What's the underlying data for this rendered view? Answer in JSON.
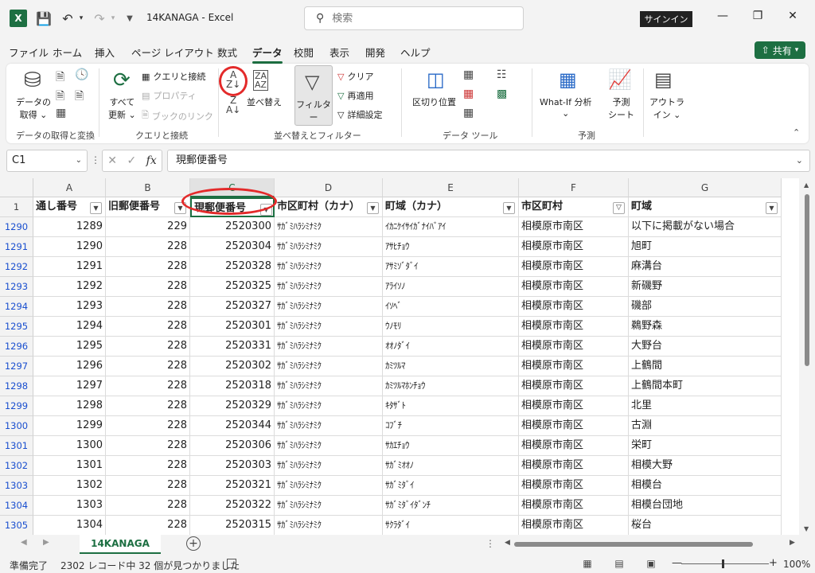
{
  "window": {
    "app_icon": "X",
    "title": "14KANAGA  -  Excel",
    "search_placeholder": "検索",
    "signin": "サインイン"
  },
  "menu": {
    "tabs": [
      "ファイル",
      "ホーム",
      "挿入",
      "ページ レイアウト",
      "数式",
      "データ",
      "校閲",
      "表示",
      "開発",
      "ヘルプ"
    ],
    "active": "データ",
    "share": "共有"
  },
  "ribbon": {
    "get_data": "データの\n取得",
    "get_data_l1": "データの",
    "get_data_l2": "取得 ⌄",
    "group1": "データの取得と変換",
    "refresh_l1": "すべて",
    "refresh_l2": "更新 ⌄",
    "queries": "クエリと接続",
    "properties": "プロパティ",
    "book_links": "ブックのリンク",
    "group2": "クエリと接続",
    "sort": "並べ替え",
    "filter": "フィルター",
    "clear": "クリア",
    "reapply": "再適用",
    "advanced": "詳細設定",
    "group3": "並べ替えとフィルター",
    "text_to_columns": "区切り位置",
    "group4": "データ ツール",
    "whatif": "What-If 分析",
    "whatif_dd": "⌄",
    "forecast_l1": "予測",
    "forecast_l2": "シート",
    "group5": "予測",
    "outline_l1": "アウトラ",
    "outline_l2": "イン ⌄"
  },
  "formula": {
    "namebox": "C1",
    "content": "現郵便番号"
  },
  "columns": [
    "A",
    "B",
    "C",
    "D",
    "E",
    "F",
    "G"
  ],
  "headers": [
    "通し番号",
    "旧郵便番号",
    "現郵便番号",
    "市区町村（カナ）",
    "町域（カナ）",
    "市区町村",
    "町域"
  ],
  "rows": [
    {
      "r": "1290",
      "a": "1289",
      "b": "229",
      "c": "2520300",
      "d": "ｻｶﾞﾐﾊﾗｼﾐﾅﾐｸ",
      "e": "ｲｶﾆｹｲｻｲｶﾞﾅｲﾊﾞｱｲ",
      "f": "相模原市南区",
      "g": "以下に掲載がない場合"
    },
    {
      "r": "1291",
      "a": "1290",
      "b": "228",
      "c": "2520304",
      "d": "ｻｶﾞﾐﾊﾗｼﾐﾅﾐｸ",
      "e": "ｱｻﾋﾁｮｳ",
      "f": "相模原市南区",
      "g": "旭町"
    },
    {
      "r": "1292",
      "a": "1291",
      "b": "228",
      "c": "2520328",
      "d": "ｻｶﾞﾐﾊﾗｼﾐﾅﾐｸ",
      "e": "ｱｻﾐｿﾞﾀﾞｲ",
      "f": "相模原市南区",
      "g": "麻溝台"
    },
    {
      "r": "1293",
      "a": "1292",
      "b": "228",
      "c": "2520325",
      "d": "ｻｶﾞﾐﾊﾗｼﾐﾅﾐｸ",
      "e": "ｱﾗｲｿﾉ",
      "f": "相模原市南区",
      "g": "新磯野"
    },
    {
      "r": "1294",
      "a": "1293",
      "b": "228",
      "c": "2520327",
      "d": "ｻｶﾞﾐﾊﾗｼﾐﾅﾐｸ",
      "e": "ｲｿﾍﾞ",
      "f": "相模原市南区",
      "g": "磯部"
    },
    {
      "r": "1295",
      "a": "1294",
      "b": "228",
      "c": "2520301",
      "d": "ｻｶﾞﾐﾊﾗｼﾐﾅﾐｸ",
      "e": "ｳﾉﾓﾘ",
      "f": "相模原市南区",
      "g": "鵜野森"
    },
    {
      "r": "1296",
      "a": "1295",
      "b": "228",
      "c": "2520331",
      "d": "ｻｶﾞﾐﾊﾗｼﾐﾅﾐｸ",
      "e": "ｵｵﾉﾀﾞｲ",
      "f": "相模原市南区",
      "g": "大野台"
    },
    {
      "r": "1297",
      "a": "1296",
      "b": "228",
      "c": "2520302",
      "d": "ｻｶﾞﾐﾊﾗｼﾐﾅﾐｸ",
      "e": "ｶﾐﾂﾙﾏ",
      "f": "相模原市南区",
      "g": "上鶴間"
    },
    {
      "r": "1298",
      "a": "1297",
      "b": "228",
      "c": "2520318",
      "d": "ｻｶﾞﾐﾊﾗｼﾐﾅﾐｸ",
      "e": "ｶﾐﾂﾙﾏﾎﾝﾁｮｳ",
      "f": "相模原市南区",
      "g": "上鶴間本町"
    },
    {
      "r": "1299",
      "a": "1298",
      "b": "228",
      "c": "2520329",
      "d": "ｻｶﾞﾐﾊﾗｼﾐﾅﾐｸ",
      "e": "ｷﾀｻﾞﾄ",
      "f": "相模原市南区",
      "g": "北里"
    },
    {
      "r": "1300",
      "a": "1299",
      "b": "228",
      "c": "2520344",
      "d": "ｻｶﾞﾐﾊﾗｼﾐﾅﾐｸ",
      "e": "ｺﾌﾞﾁ",
      "f": "相模原市南区",
      "g": "古淵"
    },
    {
      "r": "1301",
      "a": "1300",
      "b": "228",
      "c": "2520306",
      "d": "ｻｶﾞﾐﾊﾗｼﾐﾅﾐｸ",
      "e": "ｻｶｴﾁｮｳ",
      "f": "相模原市南区",
      "g": "栄町"
    },
    {
      "r": "1302",
      "a": "1301",
      "b": "228",
      "c": "2520303",
      "d": "ｻｶﾞﾐﾊﾗｼﾐﾅﾐｸ",
      "e": "ｻｶﾞﾐｵｵﾉ",
      "f": "相模原市南区",
      "g": "相模大野"
    },
    {
      "r": "1303",
      "a": "1302",
      "b": "228",
      "c": "2520321",
      "d": "ｻｶﾞﾐﾊﾗｼﾐﾅﾐｸ",
      "e": "ｻｶﾞﾐﾀﾞｲ",
      "f": "相模原市南区",
      "g": "相模台"
    },
    {
      "r": "1304",
      "a": "1303",
      "b": "228",
      "c": "2520322",
      "d": "ｻｶﾞﾐﾊﾗｼﾐﾅﾐｸ",
      "e": "ｻｶﾞﾐﾀﾞｲﾀﾞﾝﾁ",
      "f": "相模原市南区",
      "g": "相模台団地"
    },
    {
      "r": "1305",
      "a": "1304",
      "b": "228",
      "c": "2520315",
      "d": "ｻｶﾞﾐﾊﾗｼﾐﾅﾐｸ",
      "e": "ｻｸﾗﾀﾞｲ",
      "f": "相模原市南区",
      "g": "桜台"
    }
  ],
  "sheet": {
    "tab": "14KANAGA"
  },
  "status": {
    "ready": "準備完了",
    "count": "2302 レコード中 32 個が見つかりました",
    "zoom": "100%"
  },
  "colors": {
    "accent": "#1d6f42",
    "annotation": "#e32a2a",
    "row_number": "#1a4fcf"
  }
}
